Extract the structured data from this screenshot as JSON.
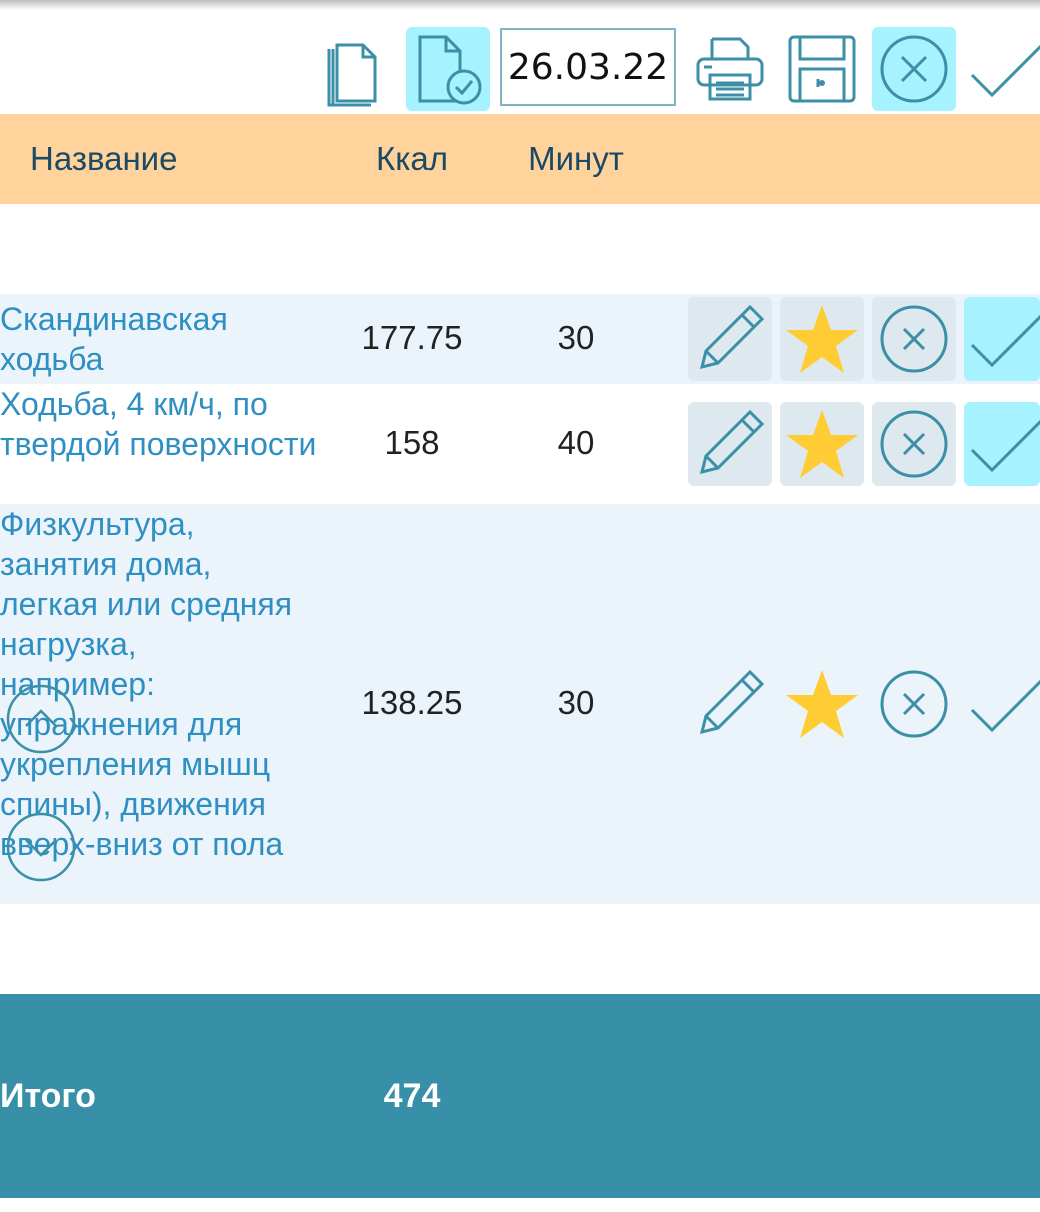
{
  "toolbar": {
    "date": "26.03.22",
    "icons": [
      "copy-icon",
      "file-check-icon",
      "printer-icon",
      "save-icon",
      "cancel-icon",
      "confirm-icon"
    ]
  },
  "table": {
    "headers": {
      "name": "Название",
      "kcal": "Ккал",
      "minutes": "Минут"
    },
    "rows": [
      {
        "name": "Скандинавская ходьба",
        "kcal": "177.75",
        "minutes": "30"
      },
      {
        "name": "Ходьба, 4 км/ч, по твердой поверхности",
        "kcal": "158",
        "minutes": "40"
      },
      {
        "name": "Физкультура, занятия дома, легкая или средняя нагрузка, например: упражнения для укрепления мышц спины), движения вверх-вниз от пола",
        "kcal": "138.25",
        "minutes": "30"
      }
    ]
  },
  "footer": {
    "label": "Итого",
    "total": "474"
  },
  "colors": {
    "header_bg": "#ffd39b",
    "footer_bg": "#388fa8",
    "accent_cyan": "#a6f3ff",
    "icon_stroke": "#3b8fa6",
    "star": "#ffcc33",
    "link_text": "#2f8fc2"
  }
}
